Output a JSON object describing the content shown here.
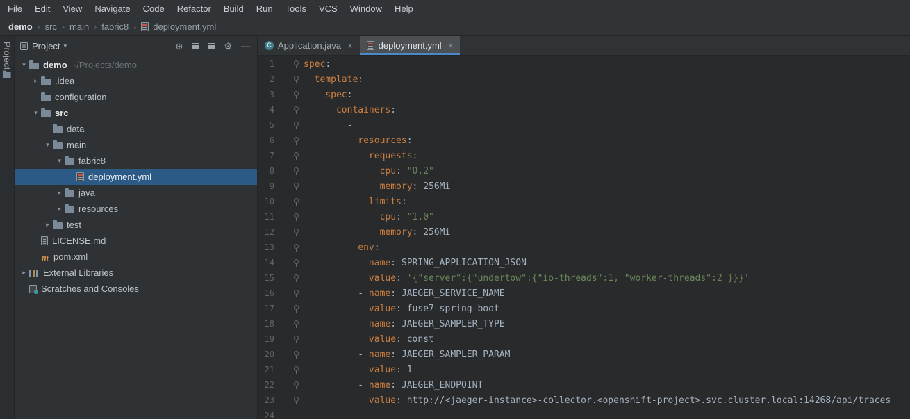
{
  "colors": {
    "accent_blue": "#4a88c7",
    "selection_blue": "#2c5a87",
    "yaml_key_orange": "#cc7f3f",
    "yaml_string_green": "#6a8759",
    "editor_text": "#a5b2bf"
  },
  "menu_bar": {
    "items": [
      "File",
      "Edit",
      "View",
      "Navigate",
      "Code",
      "Refactor",
      "Build",
      "Run",
      "Tools",
      "VCS",
      "Window",
      "Help"
    ]
  },
  "breadcrumb": {
    "items": [
      "demo",
      "src",
      "main",
      "fabric8",
      "deployment.yml"
    ]
  },
  "tool_strip": {
    "project_tab": "Project"
  },
  "project_panel": {
    "title": "Project",
    "tree": [
      {
        "label": "demo",
        "suffix": "~/Projects/demo"
      },
      {
        "label": ".idea"
      },
      {
        "label": "configuration"
      },
      {
        "label": "src"
      },
      {
        "label": "data"
      },
      {
        "label": "main"
      },
      {
        "label": "fabric8"
      },
      {
        "label": "deployment.yml"
      },
      {
        "label": "java"
      },
      {
        "label": "resources"
      },
      {
        "label": "test"
      },
      {
        "label": "LICENSE.md"
      },
      {
        "label": "pom.xml"
      },
      {
        "label": "External Libraries"
      },
      {
        "label": "Scratches and Consoles"
      }
    ]
  },
  "editor_tabs": [
    {
      "label": "Application.java"
    },
    {
      "label": "deployment.yml"
    }
  ],
  "editor": {
    "lines": [
      {
        "num": "1",
        "g": true,
        "segments": [
          {
            "c": "k",
            "t": "spec"
          },
          {
            "c": "p",
            "t": ":"
          }
        ]
      },
      {
        "num": "2",
        "g": true,
        "segments": [
          {
            "c": "k",
            "t": "  template"
          },
          {
            "c": "p",
            "t": ":"
          }
        ]
      },
      {
        "num": "3",
        "g": true,
        "segments": [
          {
            "c": "k",
            "t": "    spec"
          },
          {
            "c": "p",
            "t": ":"
          }
        ]
      },
      {
        "num": "4",
        "g": true,
        "segments": [
          {
            "c": "k",
            "t": "      containers"
          },
          {
            "c": "p",
            "t": ":"
          }
        ]
      },
      {
        "num": "5",
        "g": true,
        "segments": [
          {
            "c": "p",
            "t": "        -"
          }
        ]
      },
      {
        "num": "6",
        "g": true,
        "segments": [
          {
            "c": "k",
            "t": "          resources"
          },
          {
            "c": "p",
            "t": ":"
          }
        ]
      },
      {
        "num": "7",
        "g": true,
        "segments": [
          {
            "c": "k",
            "t": "            requests"
          },
          {
            "c": "p",
            "t": ":"
          }
        ]
      },
      {
        "num": "8",
        "g": true,
        "segments": [
          {
            "c": "k",
            "t": "              cpu"
          },
          {
            "c": "p",
            "t": ": "
          },
          {
            "c": "s",
            "t": "\"0.2\""
          }
        ]
      },
      {
        "num": "9",
        "g": true,
        "segments": [
          {
            "c": "k",
            "t": "              memory"
          },
          {
            "c": "p",
            "t": ": 256Mi"
          }
        ]
      },
      {
        "num": "10",
        "g": true,
        "segments": [
          {
            "c": "k",
            "t": "            limits"
          },
          {
            "c": "p",
            "t": ":"
          }
        ]
      },
      {
        "num": "11",
        "g": true,
        "segments": [
          {
            "c": "k",
            "t": "              cpu"
          },
          {
            "c": "p",
            "t": ": "
          },
          {
            "c": "s",
            "t": "\"1.0\""
          }
        ]
      },
      {
        "num": "12",
        "g": true,
        "segments": [
          {
            "c": "k",
            "t": "              memory"
          },
          {
            "c": "p",
            "t": ": 256Mi"
          }
        ]
      },
      {
        "num": "13",
        "g": true,
        "segments": [
          {
            "c": "k",
            "t": "          env"
          },
          {
            "c": "p",
            "t": ":"
          }
        ]
      },
      {
        "num": "14",
        "g": true,
        "segments": [
          {
            "c": "p",
            "t": "          - "
          },
          {
            "c": "k",
            "t": "name"
          },
          {
            "c": "p",
            "t": ": SPRING_APPLICATION_JSON"
          }
        ]
      },
      {
        "num": "15",
        "g": true,
        "segments": [
          {
            "c": "p",
            "t": "            "
          },
          {
            "c": "k",
            "t": "value"
          },
          {
            "c": "p",
            "t": ": "
          },
          {
            "c": "s",
            "t": "'{\"server\":{\"undertow\":{\"io-threads\":1, \"worker-threads\":2 }}}'"
          }
        ]
      },
      {
        "num": "16",
        "g": true,
        "segments": [
          {
            "c": "p",
            "t": "          - "
          },
          {
            "c": "k",
            "t": "name"
          },
          {
            "c": "p",
            "t": ": JAEGER_SERVICE_NAME"
          }
        ]
      },
      {
        "num": "17",
        "g": true,
        "segments": [
          {
            "c": "p",
            "t": "            "
          },
          {
            "c": "k",
            "t": "value"
          },
          {
            "c": "p",
            "t": ": fuse7-spring-boot"
          }
        ]
      },
      {
        "num": "18",
        "g": true,
        "segments": [
          {
            "c": "p",
            "t": "          - "
          },
          {
            "c": "k",
            "t": "name"
          },
          {
            "c": "p",
            "t": ": JAEGER_SAMPLER_TYPE"
          }
        ]
      },
      {
        "num": "19",
        "g": true,
        "segments": [
          {
            "c": "p",
            "t": "            "
          },
          {
            "c": "k",
            "t": "value"
          },
          {
            "c": "p",
            "t": ": const"
          }
        ]
      },
      {
        "num": "20",
        "g": true,
        "segments": [
          {
            "c": "p",
            "t": "          - "
          },
          {
            "c": "k",
            "t": "name"
          },
          {
            "c": "p",
            "t": ": JAEGER_SAMPLER_PARAM"
          }
        ]
      },
      {
        "num": "21",
        "g": true,
        "segments": [
          {
            "c": "p",
            "t": "            "
          },
          {
            "c": "k",
            "t": "value"
          },
          {
            "c": "p",
            "t": ": 1"
          }
        ]
      },
      {
        "num": "22",
        "g": true,
        "segments": [
          {
            "c": "p",
            "t": "          - "
          },
          {
            "c": "k",
            "t": "name"
          },
          {
            "c": "p",
            "t": ": JAEGER_ENDPOINT"
          }
        ]
      },
      {
        "num": "23",
        "g": true,
        "segments": [
          {
            "c": "p",
            "t": "            "
          },
          {
            "c": "k",
            "t": "value"
          },
          {
            "c": "p",
            "t": ": http://<jaeger-instance>-collector.<openshift-project>.svc.cluster.local:14268/api/traces"
          }
        ]
      },
      {
        "num": "24",
        "g": false,
        "segments": []
      }
    ]
  }
}
